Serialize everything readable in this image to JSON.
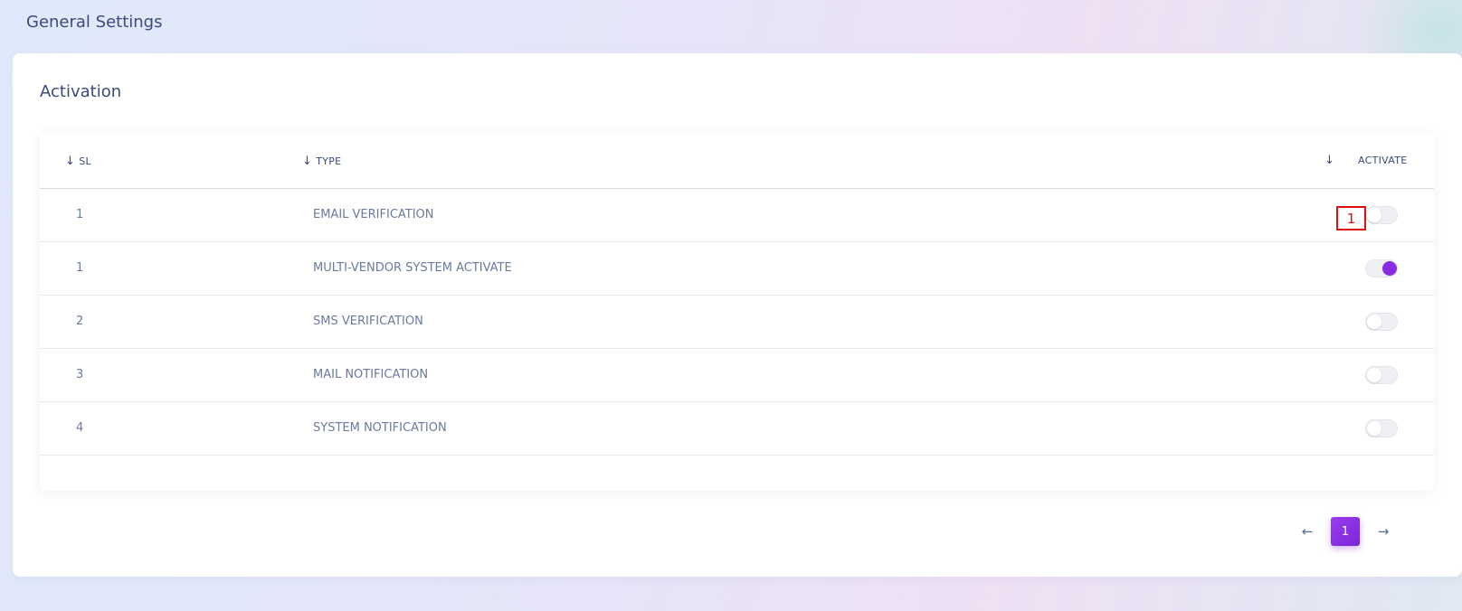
{
  "page": {
    "title": "General Settings"
  },
  "section": {
    "title": "Activation"
  },
  "table": {
    "columns": {
      "sl": "SL",
      "type": "TYPE",
      "activate": "ACTIVATE"
    },
    "rows": [
      {
        "sl": "1",
        "type": "EMAIL VERIFICATION",
        "active": false
      },
      {
        "sl": "1",
        "type": "MULTI-VENDOR SYSTEM ACTIVATE",
        "active": true
      },
      {
        "sl": "2",
        "type": "SMS VERIFICATION",
        "active": false
      },
      {
        "sl": "3",
        "type": "MAIL NOTIFICATION",
        "active": false
      },
      {
        "sl": "4",
        "type": "SYSTEM NOTIFICATION",
        "active": false
      }
    ]
  },
  "marker": {
    "label": "1"
  },
  "pagination": {
    "current": "1",
    "prev_icon": "arrow-left-icon",
    "next_icon": "arrow-right-icon"
  },
  "colors": {
    "accent": "#8a2be2",
    "heading": "#3b4a7a",
    "text_muted": "#6b7a9e",
    "marker": "#e01010"
  }
}
